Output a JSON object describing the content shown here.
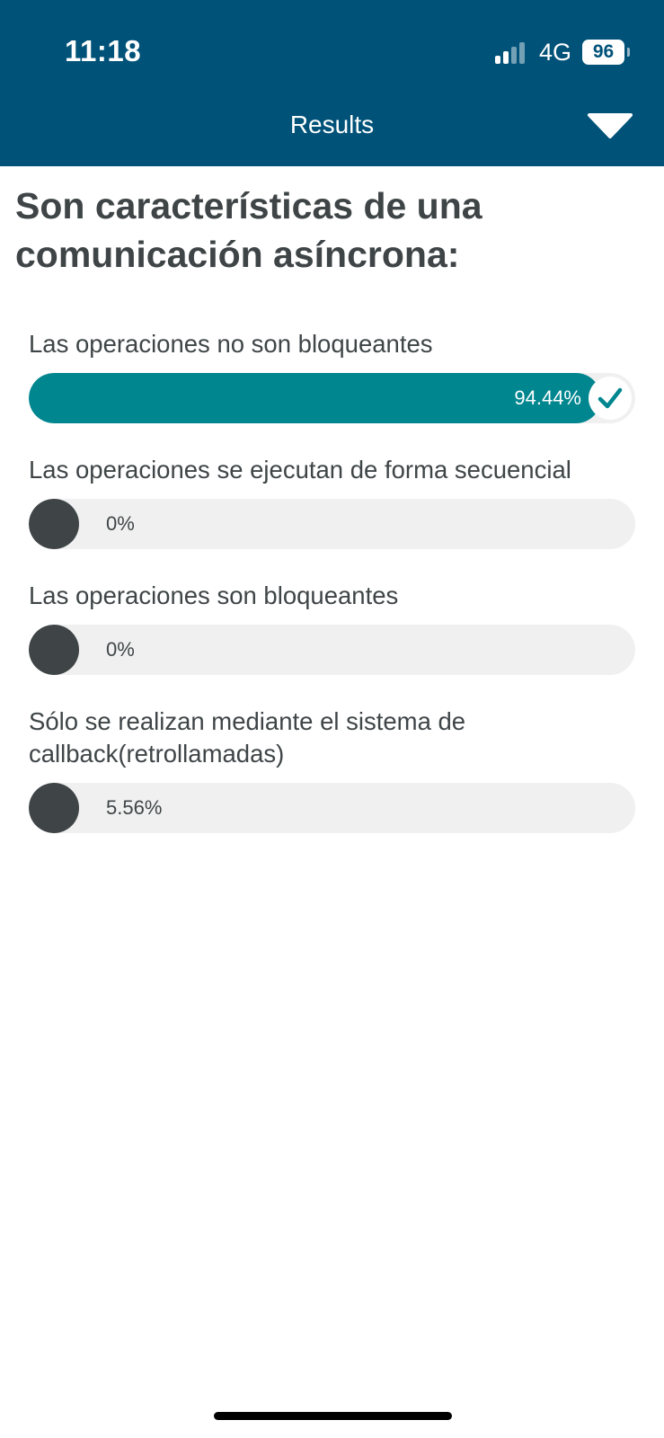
{
  "status_bar": {
    "time": "11:18",
    "network": "4G",
    "battery": "96",
    "signal_bars_active": 2,
    "signal_bars_total": 4
  },
  "header": {
    "title": "Results",
    "background": "#005278",
    "dropdown_icon": "triangle-down-icon"
  },
  "poll": {
    "question": "Son características de una comunicación asíncrona:",
    "options": [
      {
        "label": "Las operaciones no son bloqueantes",
        "percent_text": "94.44%",
        "percent": 94.44,
        "correct": true
      },
      {
        "label": "Las operaciones se ejecutan de forma secuencial",
        "percent_text": "0%",
        "percent": 0,
        "correct": false
      },
      {
        "label": "Las operaciones son bloqueantes",
        "percent_text": "0%",
        "percent": 0,
        "correct": false
      },
      {
        "label": "Sólo se realizan mediante el sistema de callback(retrollamadas)",
        "percent_text": "5.56%",
        "percent": 5.56,
        "correct": false
      }
    ]
  },
  "colors": {
    "correct_fill": "#00868f",
    "fill": "#3f4547",
    "track": "#f0f0f0",
    "text": "#3f4547"
  }
}
